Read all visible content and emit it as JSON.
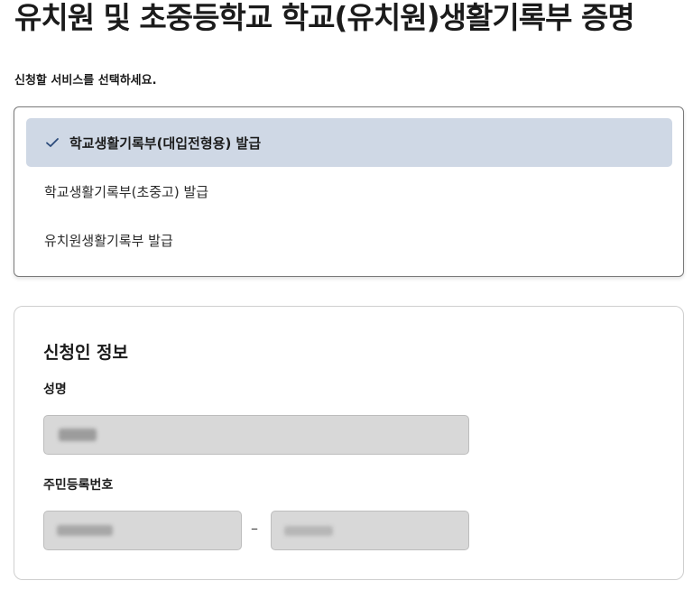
{
  "page_title": "유치원 및 초중등학교 학교(유치원)생활기록부 증명",
  "instruction": "신청할 서비스를 선택하세요.",
  "service_options": [
    {
      "label": "학교생활기록부(대입전형용) 발급",
      "selected": true
    },
    {
      "label": "학교생활기록부(초중고) 발급",
      "selected": false
    },
    {
      "label": "유치원생활기록부 발급",
      "selected": false
    }
  ],
  "applicant_section": {
    "title": "신청인 정보",
    "name_label": "성명",
    "rrn_label": "주민등록번호",
    "rrn_separator": "–"
  },
  "colors": {
    "selected_bg": "#cfd8e5",
    "check_icon": "#2b4a7a",
    "input_bg": "#d8d8d8"
  },
  "icons": {
    "selected_check": "check-icon"
  }
}
